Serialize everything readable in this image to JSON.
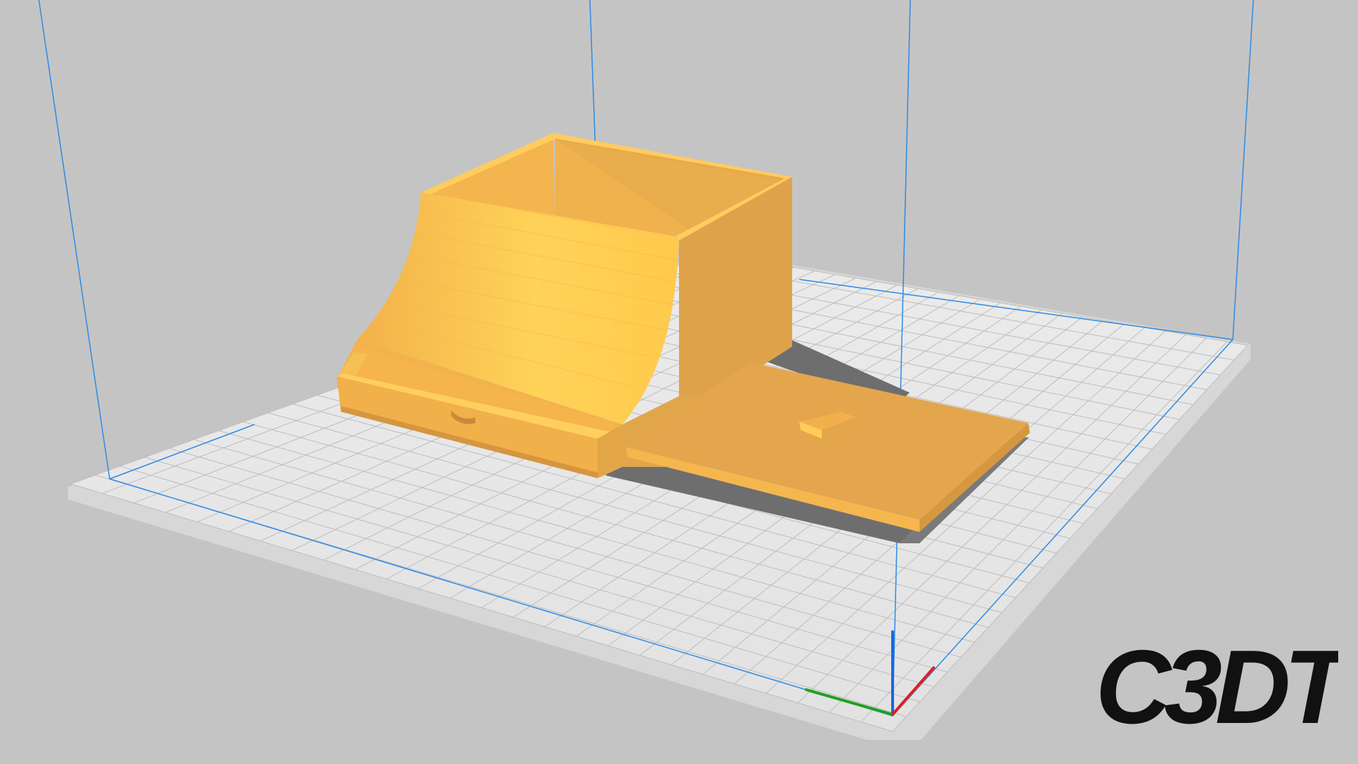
{
  "app": {
    "type": "3D printer slicer viewport"
  },
  "colors": {
    "background": "#c4c4c4",
    "build_plate": "#e6e6e6",
    "plate_border": "#d8d8d8",
    "grid_line": "#b9b9b9",
    "build_volume_edge": "#2e8ae6",
    "model_light": "#ffc94a",
    "model_mid": "#f5b94b",
    "model_dark": "#e0a24a",
    "model_shadow_face": "#d4973f",
    "shadow": "#6f6f6f",
    "axis_x": "#e02020",
    "axis_y": "#20a020",
    "axis_z": "#1a66e0",
    "watermark": "#111111"
  },
  "icons": {
    "axis_indicator": "xyz-axis-icon",
    "logo": "c3dt-logo"
  },
  "watermark": {
    "text": "C3DT"
  }
}
